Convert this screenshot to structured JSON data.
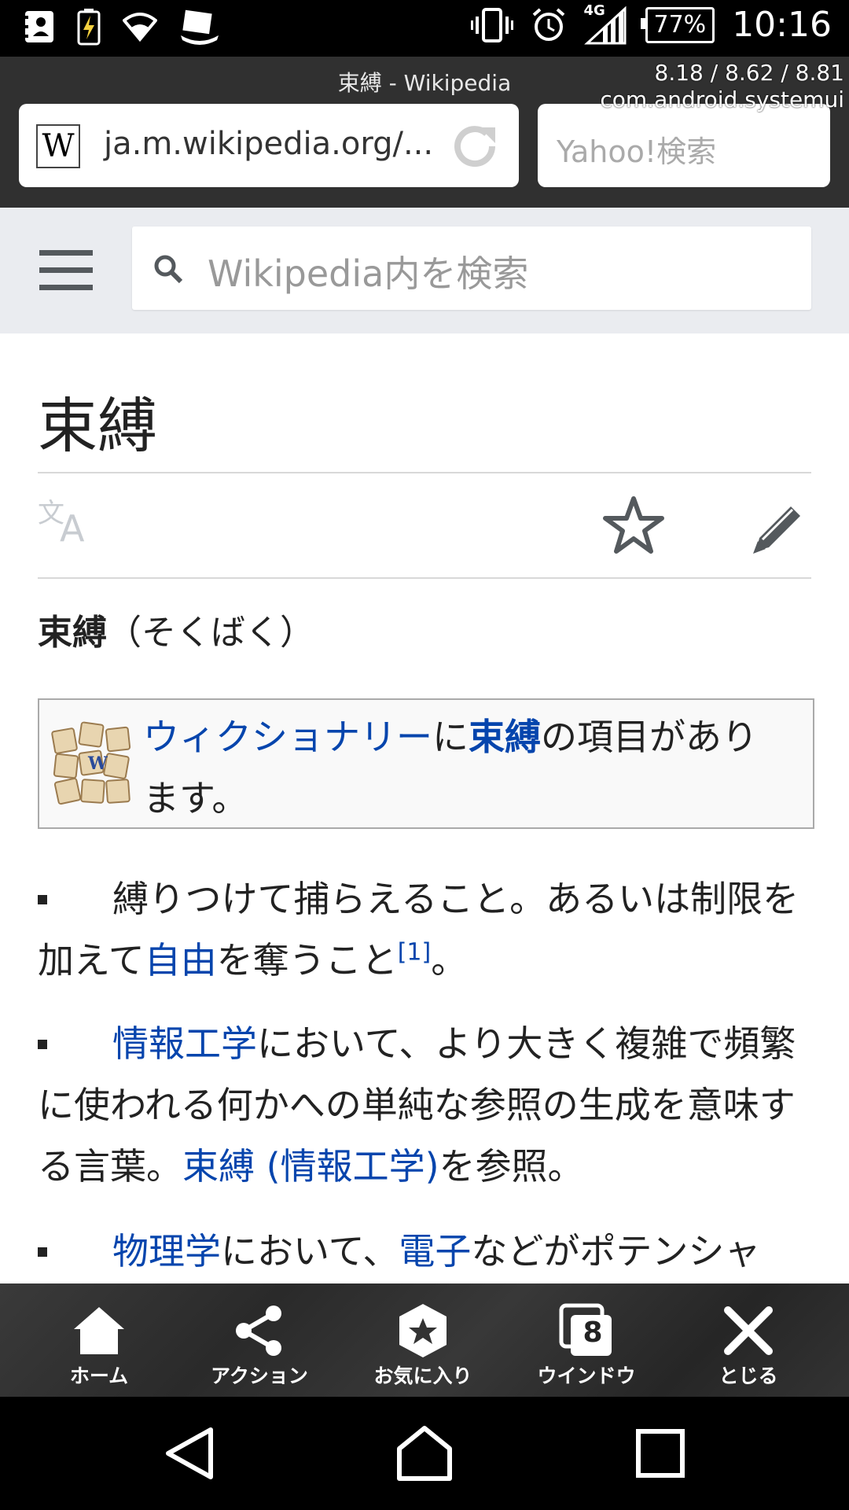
{
  "status_bar": {
    "network": "4G",
    "battery": "77%",
    "time": "10:16"
  },
  "browser": {
    "tab_title": "束縛 - Wikipedia",
    "url": "ja.m.wikipedia.org/...",
    "favicon": "W",
    "search_placeholder": "Yahoo!検索",
    "debug_line1": "8.18 / 8.62 / 8.81",
    "debug_line2": "com.android.systemui"
  },
  "wiki_header": {
    "search_placeholder": "Wikipedia内を検索"
  },
  "article": {
    "title": "束縛",
    "lead_bold": "束縛",
    "lead_reading": "（そくばく）",
    "wiktionary": {
      "link": "ウィクショナリー",
      "mid": "に",
      "term": "束縛",
      "rest": "の項目があります。"
    },
    "items": [
      {
        "t1": "縛りつけて捕らえること。あるいは制限を加えて",
        "link1": "自由",
        "t2": "を奪うこと",
        "ref": "[1]",
        "t3": "。"
      },
      {
        "link1": "情報工学",
        "t1": "において、より大きく複雑で頻繁に使われる何かへの単純な参照の生成を意味する言葉。",
        "link2": "束縛 (情報工学)",
        "t2": "を参照。"
      },
      {
        "link1": "物理学",
        "t1": "において、",
        "link2": "電子",
        "t2": "などがポテンシャ"
      }
    ]
  },
  "toolbar": {
    "home": "ホーム",
    "action": "アクション",
    "favorites": "お気に入り",
    "windows": "ウインドウ",
    "windows_count": "8",
    "close": "とじる"
  },
  "icons": [
    "contacts-icon",
    "battery-charging-icon",
    "wifi-icon",
    "cast-icon",
    "vibrate-icon",
    "alarm-icon",
    "signal-icon",
    "reload-icon",
    "menu-icon",
    "search-icon",
    "translate-icon",
    "star-icon",
    "edit-icon",
    "home-icon",
    "share-icon",
    "favorite-icon",
    "windows-icon",
    "close-icon",
    "back-icon",
    "home-nav-icon",
    "recents-icon"
  ]
}
